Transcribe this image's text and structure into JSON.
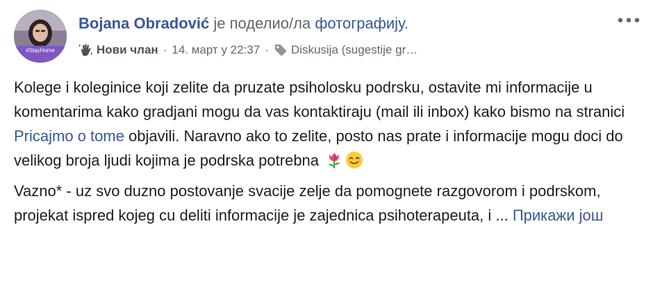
{
  "post": {
    "author": "Bojana Obradović",
    "action_text": "је поделио/ла",
    "action_object": "фотографију",
    "action_end": ".",
    "avatar_caption": "#StayHome",
    "badge": "Нови члан",
    "separator": "·",
    "timestamp": "14. март у 22:37",
    "topic": "Diskusija (sugestije gr…",
    "paragraph1_before_link": "Kolege i koleginice koji zelite da pruzate psiholosku podrsku, ostavite mi informacije u komentarima kako gradjani mogu da vas kontaktiraju (mail ili inbox) kako bismo na stranici ",
    "paragraph1_link": "Pricajmo o tome",
    "paragraph1_after_link": " objavili. Naravno ako to zelite, posto nas prate i informacije mogu doci do velikog broja ljudi kojima je podrska potrebna",
    "paragraph2": "Vazno* - uz svo duzno postovanje svacije zelje da pomognete razgovorom i podrskom, projekat ispred kojeg cu deliti informacije je zajednica psihoterapeuta, i ... ",
    "see_more": "Прикажи још"
  },
  "icons": {
    "more": "more-horizontal-icon",
    "wave": "waving-hand-icon",
    "tag": "tag-icon",
    "emoji1": "tulip-emoji",
    "emoji2": "smiling-face-emoji"
  },
  "colors": {
    "link": "#385898",
    "text": "#1c1e21",
    "meta": "#616770"
  }
}
